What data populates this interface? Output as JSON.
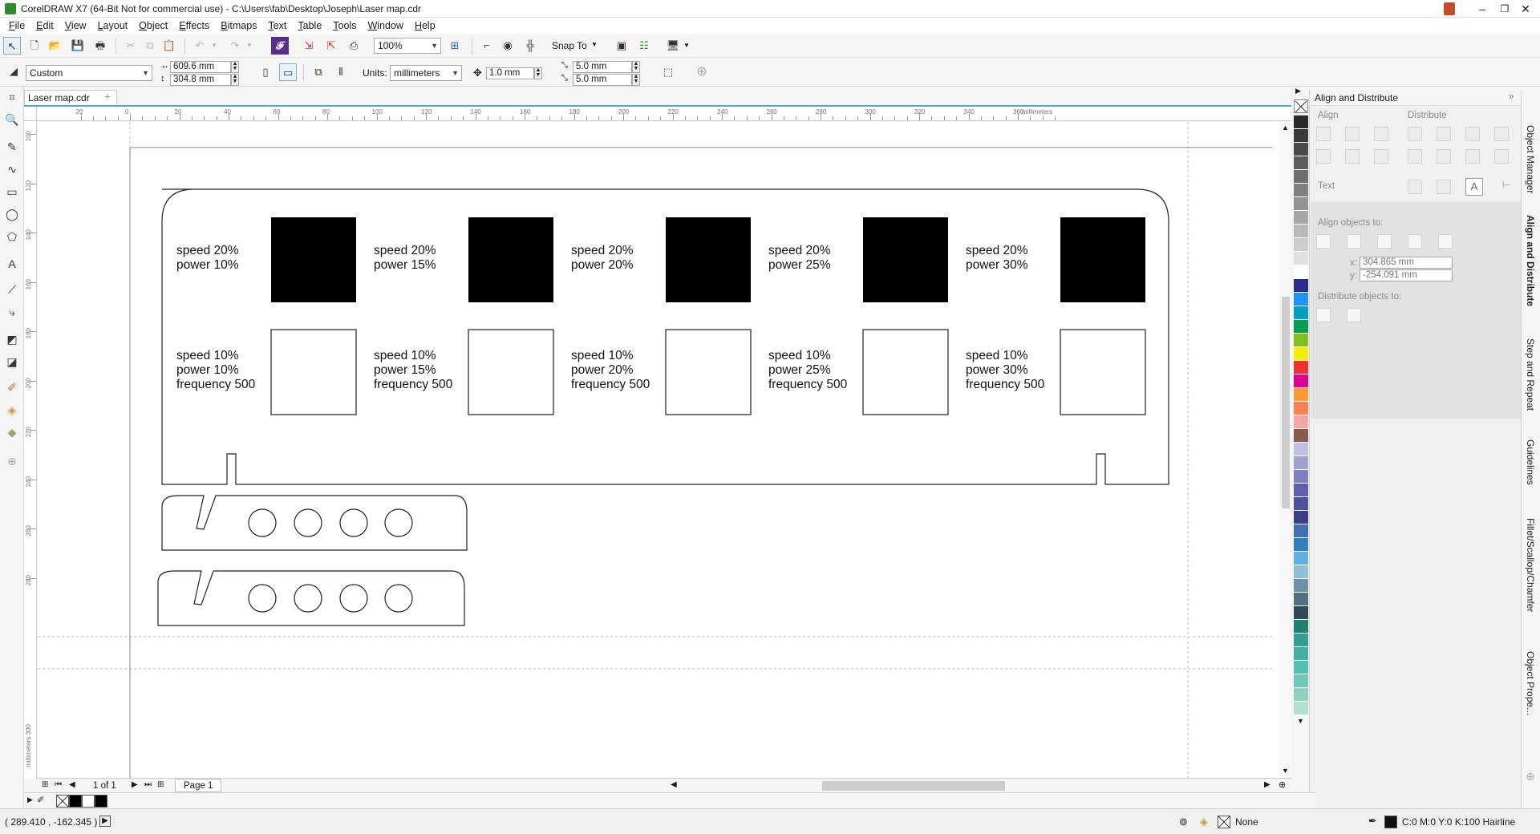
{
  "window": {
    "title": "CorelDRAW X7 (64-Bit Not for commercial use) - C:\\Users\\fab\\Desktop\\Joseph\\Laser map.cdr",
    "minimize": "–",
    "restore": "❐",
    "close": "✕"
  },
  "menu": [
    "File",
    "Edit",
    "View",
    "Layout",
    "Object",
    "Effects",
    "Bitmaps",
    "Text",
    "Table",
    "Tools",
    "Window",
    "Help"
  ],
  "toolbar": {
    "zoom": "100%",
    "snap_to": "Snap To"
  },
  "property_bar": {
    "page_preset": "Custom",
    "width": "609.6 mm",
    "height": "304.8 mm",
    "units_label": "Units:",
    "units": "millimeters",
    "nudge": "1.0 mm",
    "dup_x": "5.0 mm",
    "dup_y": "5.0 mm"
  },
  "document_tab": "Laser map.cdr",
  "ruler": {
    "unit": "millimeters",
    "h_ticks": [
      "20",
      "0",
      "20",
      "40",
      "60",
      "80",
      "100",
      "120",
      "140",
      "160",
      "180",
      "200",
      "220",
      "240",
      "260",
      "280",
      "300",
      "320",
      "340",
      "360"
    ],
    "v_ticks": [
      "100",
      "120",
      "140",
      "160",
      "180",
      "200",
      "220",
      "240",
      "260",
      "280"
    ],
    "v_unit": "millimeters 300"
  },
  "canvas": {
    "row1": [
      {
        "speed": "speed 20%",
        "power": "power 10%"
      },
      {
        "speed": "speed 20%",
        "power": "power 15%"
      },
      {
        "speed": "speed 20%",
        "power": "power 20%"
      },
      {
        "speed": "speed 20%",
        "power": "power 25%"
      },
      {
        "speed": "speed 20%",
        "power": "power 30%"
      }
    ],
    "row2": [
      {
        "speed": "speed 10%",
        "power": "power 10%",
        "frequency": "frequency 500"
      },
      {
        "speed": "speed 10%",
        "power": "power 15%",
        "frequency": "frequency 500"
      },
      {
        "speed": "speed 10%",
        "power": "power 20%",
        "frequency": "frequency 500"
      },
      {
        "speed": "speed 10%",
        "power": "power 25%",
        "frequency": "frequency 500"
      },
      {
        "speed": "speed 10%",
        "power": "power 30%",
        "frequency": "frequency 500"
      }
    ]
  },
  "page_nav": {
    "count": "1 of 1",
    "page_tab": "Page 1"
  },
  "docker": {
    "title": "Align and Distribute",
    "align_label": "Align",
    "distribute_label": "Distribute",
    "text_label": "Text",
    "align_objects_to": "Align objects to:",
    "x_label": "x:",
    "x_value": "304.865 mm",
    "y_label": "y:",
    "y_value": "-254.091 mm",
    "distribute_objects_to": "Distribute objects to:"
  },
  "side_tabs": [
    "Object Manager",
    "Align and Distribute",
    "Step and Repeat",
    "Guidelines",
    "Fillet/Scallop/Chamfer",
    "Object Prope..."
  ],
  "status": {
    "coords": "( 289.410 , -162.345 )",
    "fill_label": "None",
    "outline_label": "C:0 M:0 Y:0 K:100  Hairline"
  },
  "palette": [
    "#2b2b2b",
    "#3a3a3a",
    "#4a4a4a",
    "#5c5c5c",
    "#6e6e6e",
    "#808080",
    "#939393",
    "#a6a6a6",
    "#b9b9b9",
    "#cccccc",
    "#e0e0e0",
    "#ffffff",
    "#2c2c8c",
    "#1e90ff",
    "#00a0c0",
    "#00a050",
    "#80c020",
    "#f0f000",
    "#f03030",
    "#e00090",
    "#ff9933",
    "#ff7f50",
    "#f6a6a6",
    "#8b5a4a",
    "#c0c0e0",
    "#a0a0d0",
    "#8080c0",
    "#6060b0",
    "#5050a0",
    "#3c3c8c",
    "#4070b0",
    "#3080c0",
    "#60b0e0",
    "#90c0d8",
    "#7090a8",
    "#507088",
    "#304858",
    "#208070",
    "#30a090",
    "#40b0a0",
    "#50c0b0",
    "#70c8b8",
    "#90d0c0",
    "#b0e0d0"
  ]
}
